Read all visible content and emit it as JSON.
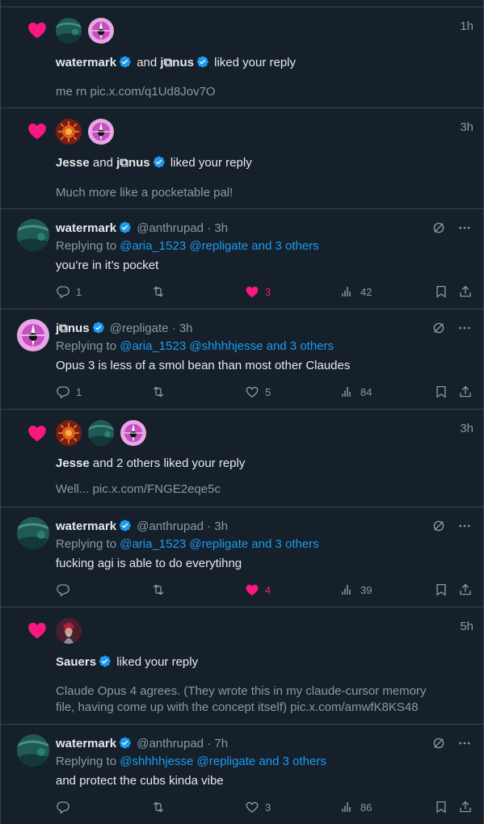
{
  "items": [
    {
      "kind": "like",
      "time": "1h",
      "actors": [
        "watermark",
        "j⧉nus"
      ],
      "join": "and",
      "action": "liked your reply",
      "quote": "me rn pic.x.com/q1Ud8Jov7O"
    },
    {
      "kind": "like",
      "time": "3h",
      "actors": [
        "Jesse",
        "j⧉nus"
      ],
      "join": "and",
      "action": "liked your reply",
      "quote": "Much more like a pocketable pal!"
    },
    {
      "kind": "reply",
      "name": "watermark",
      "handle": "@anthrupad",
      "time": "3h",
      "replying_prefix": "Replying to",
      "replying_links": "@aria_1523 @repligate and 3 others",
      "text": "you’re in it’s pocket",
      "replies": "1",
      "reposts": "",
      "likes": "3",
      "views": "42",
      "liked": true
    },
    {
      "kind": "reply",
      "name": "j⧉nus",
      "handle": "@repligate",
      "time": "3h",
      "replying_prefix": "Replying to",
      "replying_links": "@aria_1523 @shhhhjesse and 3 others",
      "text": "Opus 3 is less of a smol bean than most other Claudes",
      "replies": "1",
      "reposts": "",
      "likes": "5",
      "views": "84",
      "liked": false
    },
    {
      "kind": "like",
      "time": "3h",
      "actors": [
        "Jesse"
      ],
      "join": "and 2 others",
      "action": "liked your reply",
      "quote": "Well... pic.x.com/FNGE2eqe5c"
    },
    {
      "kind": "reply",
      "name": "watermark",
      "handle": "@anthrupad",
      "time": "3h",
      "replying_prefix": "Replying to",
      "replying_links": "@aria_1523 @repligate and 3 others",
      "text": "fucking agi is able to do everytihng",
      "replies": "",
      "reposts": "",
      "likes": "4",
      "views": "39",
      "liked": true
    },
    {
      "kind": "like",
      "time": "5h",
      "actors": [
        "Sauers"
      ],
      "join": "",
      "action": "liked your reply",
      "quote_lines": [
        "Claude Opus 4 agrees. (They wrote this in my claude-cursor memory",
        "file, having come up with the concept itself) pic.x.com/amwfK8KS48"
      ]
    },
    {
      "kind": "reply",
      "name": "watermark",
      "handle": "@anthrupad",
      "time": "7h",
      "replying_prefix": "Replying to",
      "replying_links": "@shhhhjesse @repligate and 3 others",
      "text": "and protect the cubs kinda vibe",
      "replies": "",
      "reposts": "",
      "likes": "3",
      "views": "86",
      "liked": false
    }
  ],
  "colors": {
    "background": "#15202b",
    "border": "#38444d",
    "text": "#e7e9ea",
    "muted": "#8b98a5",
    "link": "#1d9bf0",
    "like_pink": "#f91880",
    "verified": "#1d9bf0"
  },
  "icons": {
    "like_notification": "heart-icon",
    "verified": "verified-badge-icon",
    "grok": "grok-icon",
    "more": "more-icon",
    "reply": "reply-icon",
    "repost": "repost-icon",
    "like": "like-icon",
    "views": "views-icon",
    "bookmark": "bookmark-icon",
    "share": "share-icon"
  }
}
